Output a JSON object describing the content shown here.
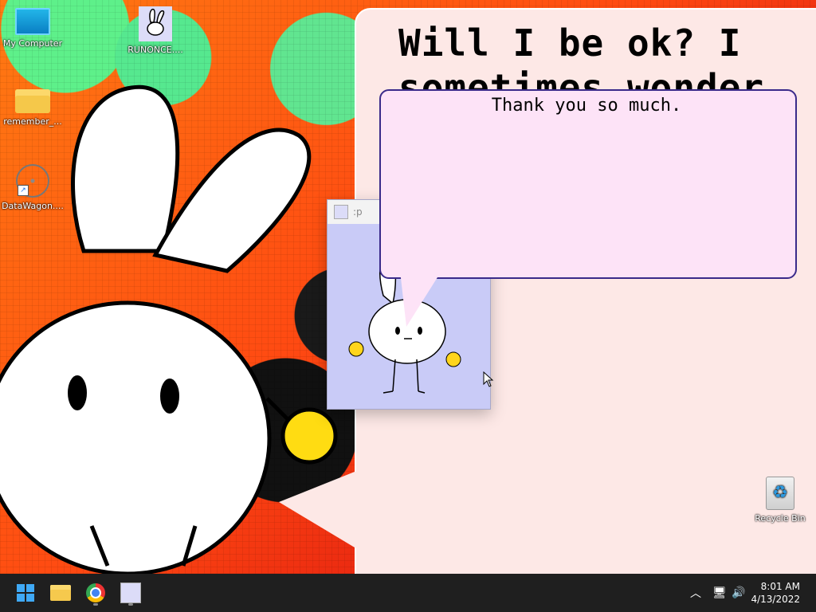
{
  "desktop": {
    "icons": [
      {
        "label": "My Computer",
        "icon": "computer-icon"
      },
      {
        "label": "RUNONCE....",
        "icon": "bunny-icon"
      },
      {
        "label": "remember_...",
        "icon": "folder-icon"
      },
      {
        "label": "DataWagon....",
        "icon": "web-shortcut-icon"
      },
      {
        "label": "Recycle Bin",
        "icon": "recycle-bin-icon"
      }
    ],
    "background_text_line1": "Will I be ok? I",
    "background_text_line2": "sometimes wonder..."
  },
  "popup": {
    "title": ":p",
    "speech": "Thank you so much."
  },
  "taskbar": {
    "apps": [
      {
        "name": "start",
        "icon": "windows-start-icon"
      },
      {
        "name": "file-explorer",
        "icon": "folder-icon"
      },
      {
        "name": "chrome",
        "icon": "chrome-icon"
      },
      {
        "name": "bunny-app",
        "icon": "bunny-icon"
      }
    ],
    "time": "8:01 AM",
    "date": "4/13/2022"
  },
  "colors": {
    "taskbar": "#1f1f1f",
    "bubble": "#fde8e6",
    "speech": "#fde3f7",
    "popup": "#c9cbf7"
  }
}
